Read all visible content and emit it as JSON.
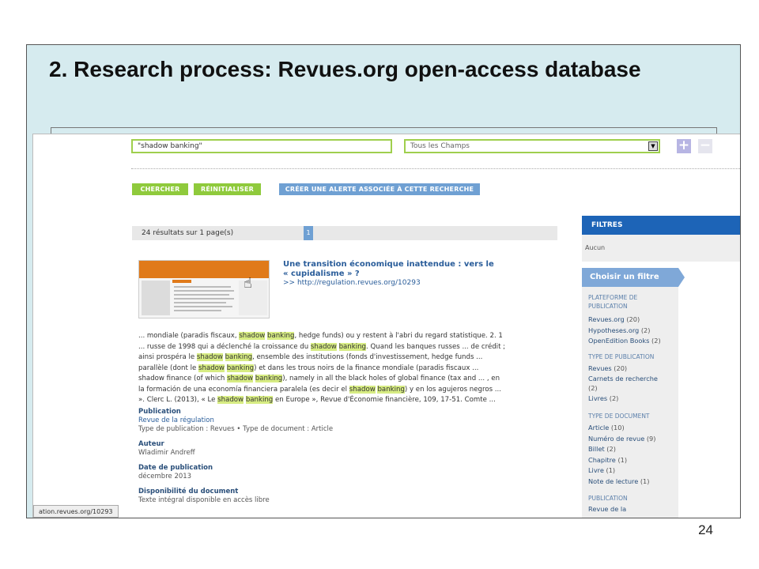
{
  "slide": {
    "title": "2. Research process: Revues.org open-access database",
    "number": "24"
  },
  "search": {
    "query": "\"shadow banking\"",
    "field": "Tous les Champs",
    "add_label": "+",
    "remove_label": "−"
  },
  "buttons": {
    "search": "CHERCHER",
    "reset": "RÉINITIALISER",
    "alert": "CRÉER UNE ALERTE ASSOCIÉE À CETTE RECHERCHE"
  },
  "results": {
    "count_text": "24 résultats sur 1 page(s)",
    "page": "1"
  },
  "result": {
    "title_line1": "Une transition économique inattendue : vers le",
    "title_line2": "« cupidalisme » ?",
    "link": ">> http://regulation.revues.org/10293",
    "excerpt_lines": [
      [
        {
          "t": "... mondiale (paradis fiscaux, ",
          "h": false
        },
        {
          "t": "shadow",
          "h": true
        },
        {
          "t": " ",
          "h": false
        },
        {
          "t": "banking",
          "h": true
        },
        {
          "t": ", hedge funds) ou y restent à l'abri du regard statistique. 2. 1",
          "h": false
        }
      ],
      [
        {
          "t": "... russe de 1998 qui a déclenché la croissance du ",
          "h": false
        },
        {
          "t": "shadow",
          "h": true
        },
        {
          "t": " ",
          "h": false
        },
        {
          "t": "banking",
          "h": true
        },
        {
          "t": ". Quand les banques russes ... de crédit ;",
          "h": false
        }
      ],
      [
        {
          "t": "ainsi prospéra le ",
          "h": false
        },
        {
          "t": "shadow",
          "h": true
        },
        {
          "t": " ",
          "h": false
        },
        {
          "t": "banking",
          "h": true
        },
        {
          "t": ", ensemble des institutions (fonds d'investissement, hedge funds ...",
          "h": false
        }
      ],
      [
        {
          "t": "parallèle (dont le ",
          "h": false
        },
        {
          "t": "shadow",
          "h": true
        },
        {
          "t": " ",
          "h": false
        },
        {
          "t": "banking",
          "h": true
        },
        {
          "t": ") et dans les trous noirs de la finance mondiale (paradis fiscaux ...",
          "h": false
        }
      ],
      [
        {
          "t": "shadow finance (of which ",
          "h": false
        },
        {
          "t": "shadow",
          "h": true
        },
        {
          "t": " ",
          "h": false
        },
        {
          "t": "banking",
          "h": true
        },
        {
          "t": "), namely in all the black holes of global finance (tax and ... , en",
          "h": false
        }
      ],
      [
        {
          "t": "la formación de una economía financiera paralela (es decir el ",
          "h": false
        },
        {
          "t": "shadow",
          "h": true
        },
        {
          "t": " ",
          "h": false
        },
        {
          "t": "banking",
          "h": true
        },
        {
          "t": ") y en los agujeros negros ...",
          "h": false
        }
      ],
      [
        {
          "t": "». Clerc L. (2013), « Le ",
          "h": false
        },
        {
          "t": "shadow",
          "h": true
        },
        {
          "t": " ",
          "h": false
        },
        {
          "t": "banking",
          "h": true
        },
        {
          "t": " en Europe », Revue d'Économie financière, 109, 17-51. Comte ...",
          "h": false
        }
      ]
    ],
    "publication_label": "Publication",
    "publication_link": "Revue de la régulation",
    "publication_type": "Type de publication : Revues • Type de document : Article",
    "author_label": "Auteur",
    "author": "Wladimir Andreff",
    "date_label": "Date de publication",
    "date": "décembre 2013",
    "availability_label": "Disponibilité du document",
    "availability": "Texte intégral disponible en accès libre"
  },
  "status_url": "ation.revues.org/10293",
  "filters": {
    "heading": "FILTRES",
    "none": "Aucun",
    "choose": "Choisir un filtre",
    "platform_label_1": "PLATEFORME DE",
    "platform_label_2": "PUBLICATION",
    "platform_items": [
      {
        "name": "Revues.org",
        "n": "(20)"
      },
      {
        "name": "Hypotheses.org",
        "n": "(2)"
      },
      {
        "name": "OpenEdition Books",
        "n": "(2)"
      }
    ],
    "pubtype_label": "TYPE DE PUBLICATION",
    "pubtype_items": [
      {
        "name": "Revues",
        "n": "(20)"
      },
      {
        "name": "Carnets de recherche",
        "n": ""
      },
      {
        "name": "",
        "n": "(2)"
      },
      {
        "name": "Livres",
        "n": "(2)"
      }
    ],
    "doctype_label": "TYPE DE DOCUMENT",
    "doctype_items": [
      {
        "name": "Article",
        "n": "(10)"
      },
      {
        "name": "Numéro de revue",
        "n": "(9)"
      },
      {
        "name": "Billet",
        "n": "(2)"
      },
      {
        "name": "Chapitre",
        "n": "(1)"
      },
      {
        "name": "Livre",
        "n": "(1)"
      },
      {
        "name": "Note de lecture",
        "n": "(1)"
      }
    ],
    "publication_label": "PUBLICATION",
    "publication_first": "Revue de la"
  }
}
